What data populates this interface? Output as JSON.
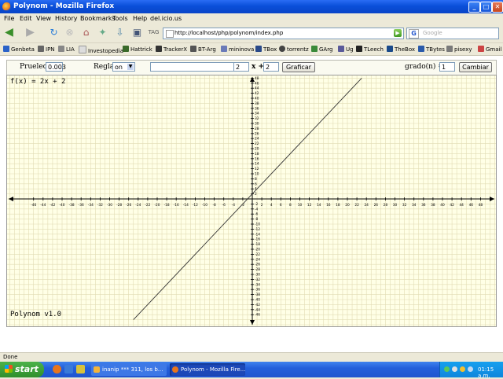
{
  "window": {
    "title": "Polynom - Mozilla Firefox"
  },
  "menu": [
    "File",
    "Edit",
    "View",
    "History",
    "Bookmarks",
    "Tools",
    "Help",
    "del.icio.us"
  ],
  "nav": {
    "url": "http://localhost/php/polynom/index.php",
    "search_placeholder": "Google",
    "search_engine_glyph": "G"
  },
  "bookmarks": [
    "Genbeta",
    "IPN",
    "LIA",
    "Investopedia",
    "Hattrick",
    "TrackerX",
    "BT-Arg",
    "mininova",
    "TBox",
    "torrentz",
    "GArg",
    "Ug",
    "TLeech",
    "TheBox",
    "TBytes",
    "pisexy",
    "Gmail"
  ],
  "controls": {
    "precision_label": "Prueleo:",
    "precision_value": "0.003",
    "rule_label": "Regla:",
    "rule_value": "on",
    "coef_a": "2",
    "x_plus": "x +",
    "coef_b": "2",
    "graph_button": "Graficar",
    "degree_label": "grado(n) =",
    "degree_value": "1",
    "change_button": "Cambiar"
  },
  "plot": {
    "function_label": "f(x) = 2x + 2",
    "version": "Polynom v1.0",
    "colors": {
      "background": "#ffffe6",
      "grid": "#e2dcb4",
      "axis": "#000000",
      "line": "#333333"
    }
  },
  "chart_data": {
    "type": "line",
    "title": "f(x) = 2x + 2",
    "xlim": [
      -50,
      50
    ],
    "ylim": [
      -49,
      49
    ],
    "x_tick_step": 2,
    "y_tick_step": 2,
    "grid": true,
    "series": [
      {
        "name": "f(x) = 2x + 2",
        "slope": 2,
        "intercept": 2
      }
    ]
  },
  "status": {
    "text": "Done"
  },
  "taskbar": {
    "start_label": "start",
    "tasks": [
      "inanip *** 311, los b...",
      "Polynom - Mozilla Fire..."
    ],
    "clock": "01:15 a.m."
  }
}
